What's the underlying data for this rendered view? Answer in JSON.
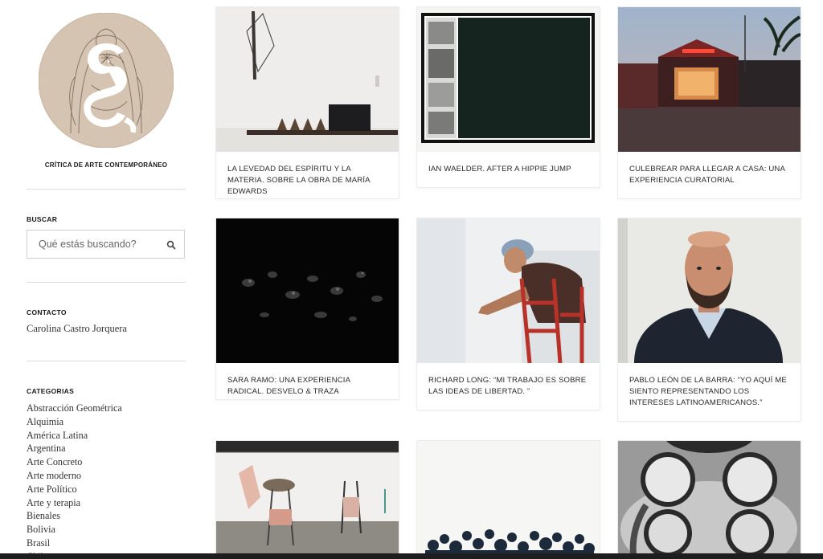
{
  "site": {
    "tagline": "CRÍTICA DE ARTE CONTEMPORÁNEO",
    "logo_icon": "snake-monogram-logo"
  },
  "search": {
    "title": "BUSCAR",
    "placeholder": "Qué estás buscando?",
    "icon": "search-icon"
  },
  "contact": {
    "title": "CONTACTO",
    "name": "Carolina Castro Jorquera"
  },
  "categories": {
    "title": "CATEGORIAS",
    "items": [
      "Abstracción Geométrica",
      "Alquimia",
      "América Latina",
      "Argentina",
      "Arte Concreto",
      "Arte moderno",
      "Arte Político",
      "Arte y terapia",
      "Bienales",
      "Bolivia",
      "Brasil",
      "Chile"
    ]
  },
  "posts": [
    {
      "title": "LA LEVEDAD DEL ESPÍRITU Y LA MATERIA. SOBRE LA OBRA DE MARÍA EDWARDS"
    },
    {
      "title": "IAN WAELDER. AFTER A HIPPIE JUMP"
    },
    {
      "title": "CULEBREAR PARA LLEGAR A CASA: UNA EXPERIENCIA CURATORIAL"
    },
    {
      "title": "SARA RAMO: UNA EXPERIENCIA RADICAL. DESVELO & TRAZA"
    },
    {
      "title": "RICHARD LONG: “MI TRABAJO ES SOBRE LAS IDEAS DE LIBERTAD. ”"
    },
    {
      "title": "PABLO LEÓN DE LA BARRA: “YO AQUÍ ME SIENTO REPRESENTANDO LOS INTERESES LATINOAMERICANOS.”"
    },
    {
      "title": ""
    },
    {
      "title": ""
    },
    {
      "title": ""
    }
  ],
  "colors": {
    "logo_bg": "#d4c2b0",
    "card_border": "#ececec",
    "text": "#2a2a2a"
  }
}
